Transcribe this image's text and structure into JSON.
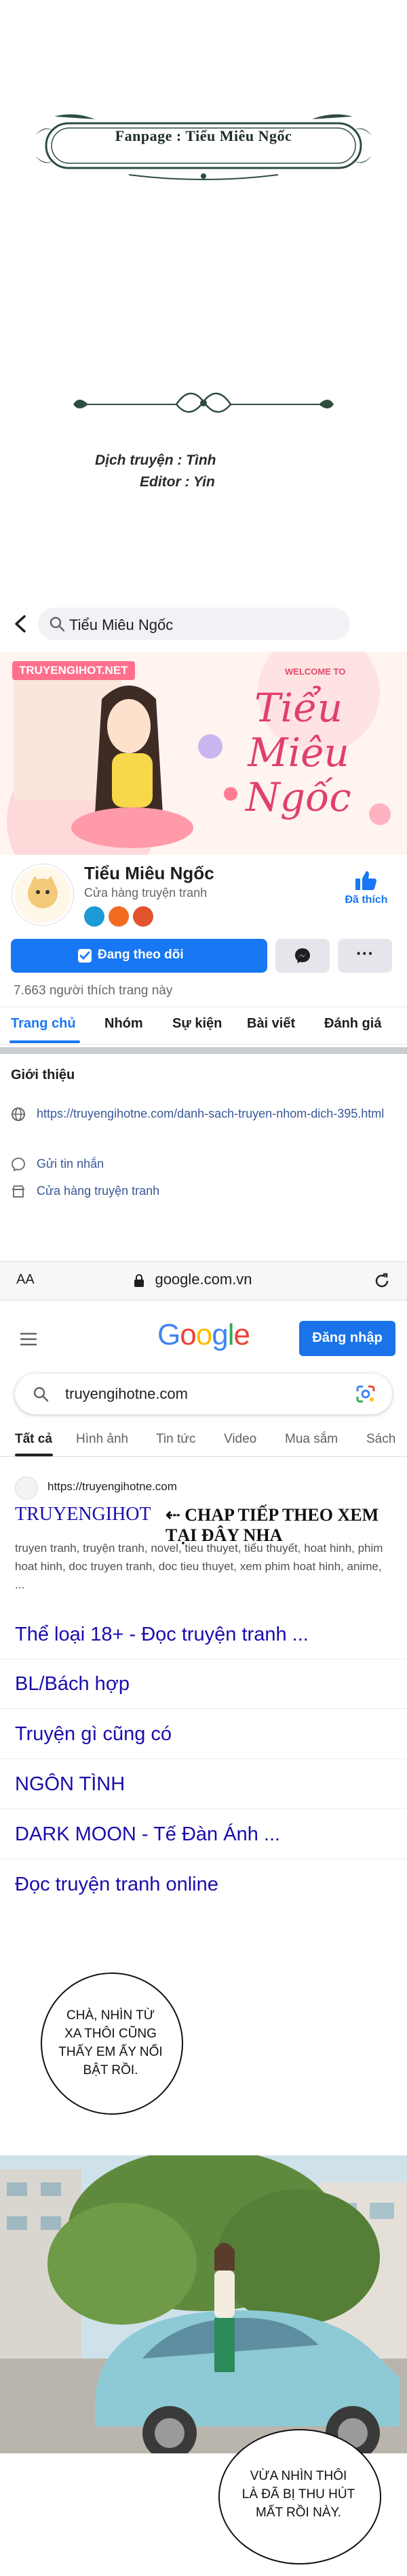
{
  "credits": {
    "fanpage": "Fanpage : Tiểu Miêu Ngốc",
    "translator": "Dịch truyện : Tình",
    "editor": "Editor : Yin"
  },
  "facebook": {
    "search_value": "Tiểu Miêu Ngốc",
    "cover_site_label": "TRUYENGIHOT.NET",
    "cover_welcome": "WELCOME TO",
    "cover_script": "Tiểu Miêu Ngốc",
    "page_name": "Tiểu Miêu Ngốc",
    "page_category": "Cửa hàng truyện tranh",
    "like_label": "Đã thích",
    "follow_button": "Đang theo dõi",
    "likes_count": "7.663 người thích trang này",
    "tabs": [
      "Trang chủ",
      "Nhóm",
      "Sự kiện",
      "Bài viết",
      "Đánh giá"
    ],
    "intro_title": "Giới thiệu",
    "intro_link": "https://truyengihotne.com/danh-sach-truyen-nhom-dich-395.html",
    "send_message": "Gửi tin nhắn",
    "shop_label": "Cửa hàng truyện tranh"
  },
  "browser": {
    "aa": "AA",
    "url": "google.com.vn"
  },
  "google": {
    "logo": "Google",
    "signin": "Đăng nhập",
    "query": "truyengihotne.com",
    "tabs": [
      "Tất cả",
      "Hình ảnh",
      "Tin tức",
      "Video",
      "Mua sắm",
      "Sách"
    ],
    "result_url": "https://truyengihotne.com",
    "result_title": "TRUYENGIHOT",
    "chap_next": "⇠ CHAP TIẾP THEO XEM TẠI ĐÂY NHA",
    "snippet": "truyen tranh, truyện tranh, novel, tieu thuyet, tiểu thuyết, hoat hinh, phim hoat hinh, doc truyen tranh, doc tieu thuyet, xem phim hoat hinh, anime, ...",
    "links": [
      "Thể loại 18+ - Đọc truyện tranh ...",
      "BL/Bách hợp",
      "Truyện gì cũng có",
      "NGÔN TÌNH",
      "DARK MOON - Tế Đàn Ánh ...",
      "Đọc truyện tranh online"
    ]
  },
  "comic": {
    "bubble1": [
      "CHÀ, NHÌN TỪ",
      "XA THÔI CŨNG",
      "THẤY EM ẤY NỔI",
      "BẬT RỒI."
    ],
    "bubble2": [
      "VỪA NHÌN THÔI",
      "LÀ ĐÃ BỊ THU HÚT",
      "MẤT RỒI NÀY."
    ]
  },
  "colors": {
    "facebook_blue": "#1877f2",
    "google_link": "#1a0dab",
    "frame_green": "#2e4d3f"
  }
}
